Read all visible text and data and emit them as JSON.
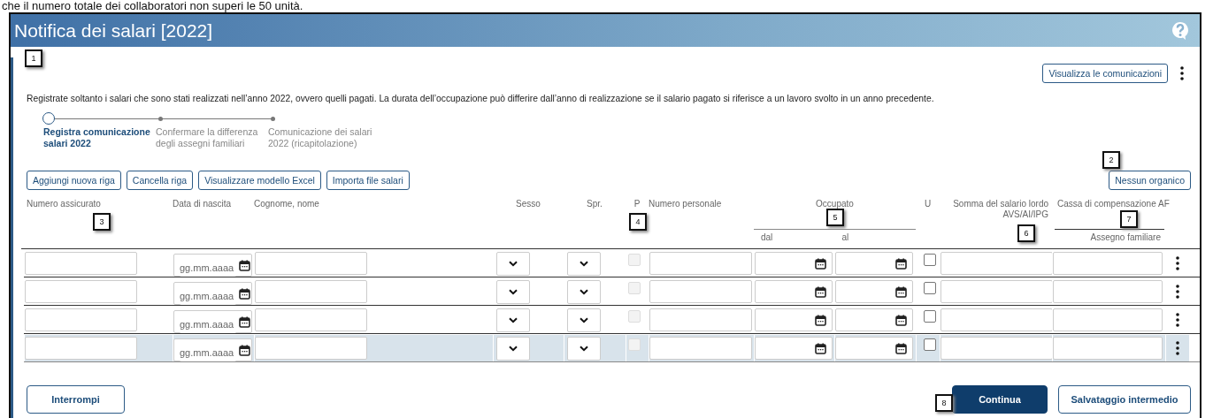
{
  "doc_line": "che il numero totale dei collaboratori non superi le 50 unità.",
  "window": {
    "title": "Notifica dei salari [2022]"
  },
  "markers": [
    {
      "label": "1"
    },
    {
      "label": "2"
    },
    {
      "label": "3"
    },
    {
      "label": "4"
    },
    {
      "label": "5"
    },
    {
      "label": "6"
    },
    {
      "label": "7"
    },
    {
      "label": "8"
    }
  ],
  "header_button": "Visualizza le comunicazioni",
  "intro": "Registrate soltanto i salari che sono stati realizzati nell’anno 2022, ovvero quelli pagati. La durata dell’occupazione può differire dall’anno di realizzazione se il salario pagato si riferisce a un lavoro svolto in un anno precedente.",
  "steps": [
    {
      "label": "Registra comunicazione salari 2022",
      "selected": true
    },
    {
      "label": "Confermare la differenza degli assegni familiari",
      "selected": false
    },
    {
      "label": "Comunicazione dei salari 2022 (ricapitolazione)",
      "selected": false
    }
  ],
  "toolbar": [
    "Aggiungi nuova riga",
    "Cancella riga",
    "Visualizzare modello Excel",
    "Importa file salari"
  ],
  "staff_button": "Nessun organico",
  "table": {
    "columns": {
      "insured_number": "Numero assicurato",
      "birth_date": "Data di nascita",
      "name": "Cognome, nome",
      "sex": "Sesso",
      "spr": "Spr.",
      "p": "P",
      "personal_number": "Numero personale",
      "employed": "Occupato",
      "employed_from": "dal",
      "employed_to": "al",
      "u": "U",
      "gross_salary": "Somma del salario lordo AVS/AI/IPG",
      "fund": "Cassa di compensazione AF",
      "family_allowance": "Assegno familiare"
    },
    "rows": [
      {
        "selected": false,
        "date_placeholder": "gg.mm.aaaa",
        "p_checked": false,
        "p_disabled": true,
        "u_checked": false
      },
      {
        "selected": false,
        "date_placeholder": "gg.mm.aaaa",
        "p_checked": false,
        "p_disabled": true,
        "u_checked": false
      },
      {
        "selected": false,
        "date_placeholder": "gg.mm.aaaa",
        "p_checked": false,
        "p_disabled": true,
        "u_checked": false
      },
      {
        "selected": true,
        "date_placeholder": "gg.mm.aaaa",
        "p_checked": false,
        "p_disabled": true,
        "u_checked": false
      }
    ]
  },
  "footer": {
    "cancel": "Interrompi",
    "continue": "Continua",
    "save": "Salvataggio intermedio"
  }
}
